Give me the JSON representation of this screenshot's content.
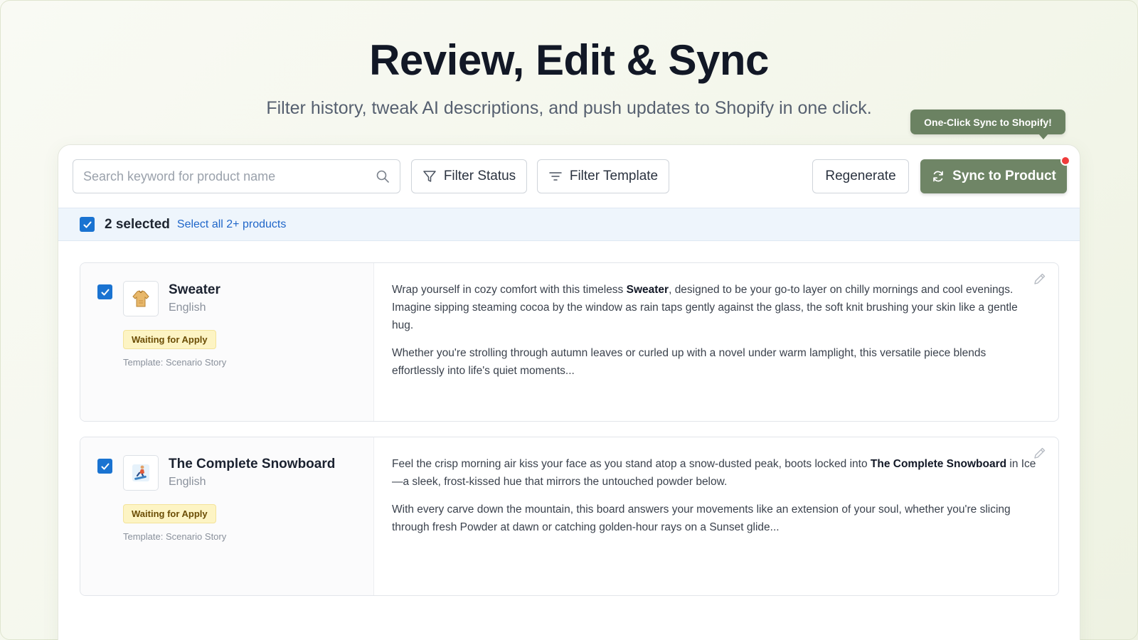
{
  "hero": {
    "title": "Review, Edit & Sync",
    "subtitle": "Filter history, tweak AI descriptions, and push updates to Shopify in one click."
  },
  "tooltip": {
    "text": "One-Click Sync to Shopify!"
  },
  "toolbar": {
    "search_placeholder": "Search keyword for product name",
    "search_value": "",
    "filter_status_label": "Filter Status",
    "filter_template_label": "Filter Template",
    "regenerate_label": "Regenerate",
    "sync_label": "Sync to Product"
  },
  "selection": {
    "checked": true,
    "count_text": "2 selected",
    "select_all_text": "Select all 2+ products"
  },
  "products": [
    {
      "checked": true,
      "thumb_icon": "sweater-icon",
      "name": "Sweater",
      "language": "English",
      "status": "Waiting for Apply",
      "template": "Template: Scenario Story",
      "paragraphs": [
        [
          "Wrap yourself in cozy comfort with this timeless ",
          "Sweater",
          ", designed to be your go-to layer on chilly mornings and cool evenings. Imagine sipping steaming cocoa by the window as rain taps gently against the glass, the soft knit brushing your skin like a gentle hug."
        ],
        [
          "Whether you're strolling through autumn leaves or curled up with a novel under warm lamplight, this versatile piece blends effortlessly into life's quiet moments..."
        ]
      ]
    },
    {
      "checked": true,
      "thumb_icon": "snowboarder-icon",
      "name": "The Complete Snowboard",
      "language": "English",
      "status": "Waiting for Apply",
      "template": "Template: Scenario Story",
      "paragraphs": [
        [
          "Feel the crisp morning air kiss your face as you stand atop a snow-dusted peak, boots locked into ",
          "The Complete Snowboard",
          " in Ice—a sleek, frost-kissed hue that mirrors the untouched powder below."
        ],
        [
          "With every carve down the mountain, this board answers your movements like an extension of your soul, whether you're slicing through fresh Powder at dawn or catching golden-hour rays on a Sunset glide..."
        ]
      ]
    }
  ],
  "colors": {
    "accent": "#6f8566",
    "checkbox": "#1a73d1",
    "badge_bg": "#fdf4c4",
    "notification": "#ef3b3b",
    "link": "#1f66c9"
  }
}
